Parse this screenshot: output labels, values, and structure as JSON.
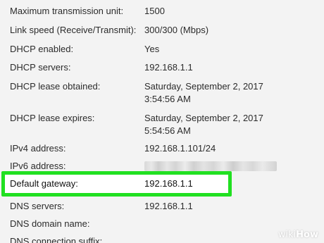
{
  "details": [
    {
      "label": "Maximum transmission unit:",
      "value": [
        "1500"
      ]
    },
    {
      "label": "Link speed (Receive/Transmit):",
      "value": [
        "300/300 (Mbps)"
      ]
    },
    {
      "label": "DHCP enabled:",
      "value": [
        "Yes"
      ]
    },
    {
      "label": "DHCP servers:",
      "value": [
        "192.168.1.1"
      ]
    },
    {
      "label": "DHCP lease obtained:",
      "value": [
        "Saturday, September 2, 2017",
        "3:54:56 AM"
      ]
    },
    {
      "label": "DHCP lease expires:",
      "value": [
        "Saturday, September 2, 2017",
        "5:54:56 AM"
      ]
    },
    {
      "label": "IPv4 address:",
      "value": [
        "192.168.1.101/24"
      ]
    },
    {
      "label": "IPv6 address:",
      "value": []
    },
    {
      "label": "Default gateway:",
      "value": [
        "192.168.1.1"
      ]
    },
    {
      "label": "DNS servers:",
      "value": [
        "192.168.1.1"
      ]
    },
    {
      "label": "DNS domain name:",
      "value": []
    },
    {
      "label": "DNS connection suffix:",
      "value": []
    }
  ],
  "highlight_color": "#21e021",
  "watermark": {
    "prefix": "wiki",
    "suffix": "How"
  }
}
